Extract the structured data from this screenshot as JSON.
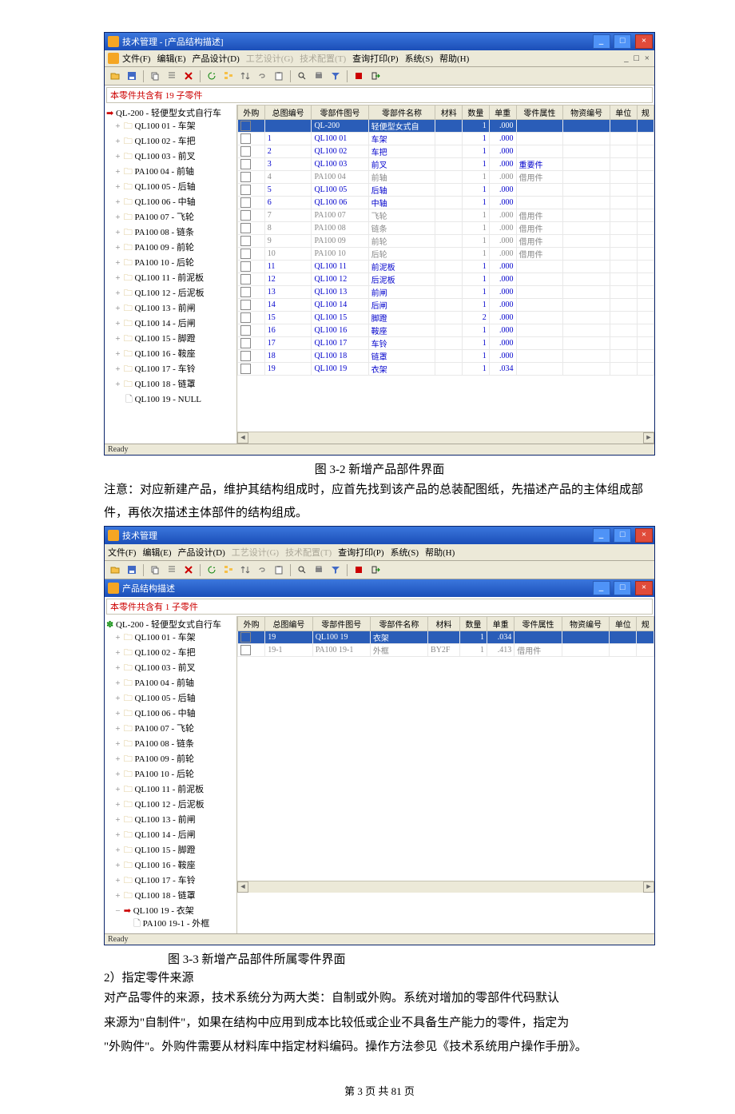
{
  "win1": {
    "title": "技术管理  -  [产品结构描述]",
    "info": "本零件共含有 19 子零件",
    "status": "Ready"
  },
  "win2": {
    "title": "技术管理",
    "sub": "产品结构描述",
    "info": "本零件共含有 1 子零件",
    "status": "Ready"
  },
  "menu": {
    "file": "文件(F)",
    "edit": "编辑(E)",
    "design": "产品设计(D)",
    "proc": "工艺设计(G)",
    "tech": "技术配置(T)",
    "query": "查询打印(P)",
    "sys": "系统(S)",
    "help": "帮助(H)"
  },
  "cols": {
    "c0": "外购",
    "c1": "总图编号",
    "c2": "零部件图号",
    "c3": "零部件名称",
    "c4": "材料",
    "c5": "数量",
    "c6": "单重",
    "c7": "零件属性",
    "c8": "物资编号",
    "c9": "单位",
    "c10": "规"
  },
  "tree1": {
    "root": "QL-200 - 轻便型女式自行车",
    "items": [
      {
        "c": "QL100 01",
        "n": "车架"
      },
      {
        "c": "QL100 02",
        "n": "车把"
      },
      {
        "c": "QL100 03",
        "n": "前叉"
      },
      {
        "c": "PA100 04",
        "n": "前轴"
      },
      {
        "c": "QL100 05",
        "n": "后轴"
      },
      {
        "c": "QL100 06",
        "n": "中轴"
      },
      {
        "c": "PA100 07",
        "n": "飞轮"
      },
      {
        "c": "PA100 08",
        "n": "链条"
      },
      {
        "c": "PA100 09",
        "n": "前轮"
      },
      {
        "c": "PA100 10",
        "n": "后轮"
      },
      {
        "c": "QL100 11",
        "n": "前泥板"
      },
      {
        "c": "QL100 12",
        "n": "后泥板"
      },
      {
        "c": "QL100 13",
        "n": "前闸"
      },
      {
        "c": "QL100 14",
        "n": "后闸"
      },
      {
        "c": "QL100 15",
        "n": "脚蹬"
      },
      {
        "c": "QL100 16",
        "n": "鞍座"
      },
      {
        "c": "QL100 17",
        "n": "车铃"
      },
      {
        "c": "QL100 18",
        "n": "链罩"
      },
      {
        "c": "QL100 19",
        "n": "NULL",
        "leaf": true
      }
    ]
  },
  "grid1": {
    "rows": [
      {
        "hl": true,
        "idx": "",
        "code": "QL-200",
        "name": "轻便型女式自",
        "qty": "1",
        "wt": ".000",
        "attr": "",
        "blue": true
      },
      {
        "idx": "1",
        "code": "QL100 01",
        "name": "车架",
        "qty": "1",
        "wt": ".000",
        "attr": "",
        "blue": true
      },
      {
        "idx": "2",
        "code": "QL100 02",
        "name": "车把",
        "qty": "1",
        "wt": ".000",
        "attr": "",
        "blue": true
      },
      {
        "idx": "3",
        "code": "QL100 03",
        "name": "前叉",
        "qty": "1",
        "wt": ".000",
        "attr": "重要件",
        "blue": true
      },
      {
        "idx": "4",
        "code": "PA100 04",
        "name": "前轴",
        "qty": "1",
        "wt": ".000",
        "attr": "借用件",
        "blue": false
      },
      {
        "idx": "5",
        "code": "QL100 05",
        "name": "后轴",
        "qty": "1",
        "wt": ".000",
        "attr": "",
        "blue": true
      },
      {
        "idx": "6",
        "code": "QL100 06",
        "name": "中轴",
        "qty": "1",
        "wt": ".000",
        "attr": "",
        "blue": true
      },
      {
        "idx": "7",
        "code": "PA100 07",
        "name": "飞轮",
        "qty": "1",
        "wt": ".000",
        "attr": "借用件",
        "blue": false
      },
      {
        "idx": "8",
        "code": "PA100 08",
        "name": "链条",
        "qty": "1",
        "wt": ".000",
        "attr": "借用件",
        "blue": false
      },
      {
        "idx": "9",
        "code": "PA100 09",
        "name": "前轮",
        "qty": "1",
        "wt": ".000",
        "attr": "借用件",
        "blue": false
      },
      {
        "idx": "10",
        "code": "PA100 10",
        "name": "后轮",
        "qty": "1",
        "wt": ".000",
        "attr": "借用件",
        "blue": false
      },
      {
        "idx": "11",
        "code": "QL100 11",
        "name": "前泥板",
        "qty": "1",
        "wt": ".000",
        "attr": "",
        "blue": true
      },
      {
        "idx": "12",
        "code": "QL100 12",
        "name": "后泥板",
        "qty": "1",
        "wt": ".000",
        "attr": "",
        "blue": true
      },
      {
        "idx": "13",
        "code": "QL100 13",
        "name": "前闸",
        "qty": "1",
        "wt": ".000",
        "attr": "",
        "blue": true
      },
      {
        "idx": "14",
        "code": "QL100 14",
        "name": "后闸",
        "qty": "1",
        "wt": ".000",
        "attr": "",
        "blue": true
      },
      {
        "idx": "15",
        "code": "QL100 15",
        "name": "脚蹬",
        "qty": "2",
        "wt": ".000",
        "attr": "",
        "blue": true
      },
      {
        "idx": "16",
        "code": "QL100 16",
        "name": "鞍座",
        "qty": "1",
        "wt": ".000",
        "attr": "",
        "blue": true
      },
      {
        "idx": "17",
        "code": "QL100 17",
        "name": "车铃",
        "qty": "1",
        "wt": ".000",
        "attr": "",
        "blue": true
      },
      {
        "idx": "18",
        "code": "QL100 18",
        "name": "链罩",
        "qty": "1",
        "wt": ".000",
        "attr": "",
        "blue": true
      },
      {
        "idx": "19",
        "code": "QL100 19",
        "name": "衣架",
        "qty": "1",
        "wt": ".034",
        "attr": "",
        "blue": true
      }
    ]
  },
  "tree2": {
    "root": "QL-200 - 轻便型女式自行车",
    "items": [
      {
        "c": "QL100 01",
        "n": "车架"
      },
      {
        "c": "QL100 02",
        "n": "车把"
      },
      {
        "c": "QL100 03",
        "n": "前叉"
      },
      {
        "c": "PA100 04",
        "n": "前轴"
      },
      {
        "c": "QL100 05",
        "n": "后轴"
      },
      {
        "c": "QL100 06",
        "n": "中轴"
      },
      {
        "c": "PA100 07",
        "n": "飞轮"
      },
      {
        "c": "PA100 08",
        "n": "链条"
      },
      {
        "c": "PA100 09",
        "n": "前轮"
      },
      {
        "c": "PA100 10",
        "n": "后轮"
      },
      {
        "c": "QL100 11",
        "n": "前泥板"
      },
      {
        "c": "QL100 12",
        "n": "后泥板"
      },
      {
        "c": "QL100 13",
        "n": "前闸"
      },
      {
        "c": "QL100 14",
        "n": "后闸"
      },
      {
        "c": "QL100 15",
        "n": "脚蹬"
      },
      {
        "c": "QL100 16",
        "n": "鞍座"
      },
      {
        "c": "QL100 17",
        "n": "车铃"
      },
      {
        "c": "QL100 18",
        "n": "链罩"
      }
    ],
    "sel": {
      "c": "QL100 19",
      "n": "衣架"
    },
    "child": {
      "c": "PA100 19-1",
      "n": "外框"
    }
  },
  "grid2": {
    "rows": [
      {
        "hl": true,
        "idx": "19",
        "code": "QL100 19",
        "name": "衣架",
        "mat": "",
        "qty": "1",
        "wt": ".034",
        "attr": ""
      },
      {
        "idx": "19-1",
        "code": "PA100 19-1",
        "name": "外框",
        "mat": "BY2F",
        "qty": "1",
        "wt": ".413",
        "attr": "借用件"
      }
    ]
  },
  "text": {
    "cap1": "图 3-2 新增产品部件界面",
    "p1": "注意：对应新建产品，维护其结构组成时，应首先找到该产品的总装配图纸，先描述产品的主体组成部件，再依次描述主体部件的结构组成。",
    "cap2": "图 3-3  新增产品部件所属零件界面",
    "h2": "2）指定零件来源",
    "p2a": "对产品零件的来源，技术系统分为两大类：自制或外购。系统对增加的零部件代码默认",
    "p2b": "来源为\"自制件\"，如果在结构中应用到成本比较低或企业不具备生产能力的零件，指定为",
    "p2c": "\"外购件\"。外购件需要从材料库中指定材料编码。操作方法参见《技术系统用户操作手册》。",
    "foot": "第  3  页  共  81  页"
  }
}
